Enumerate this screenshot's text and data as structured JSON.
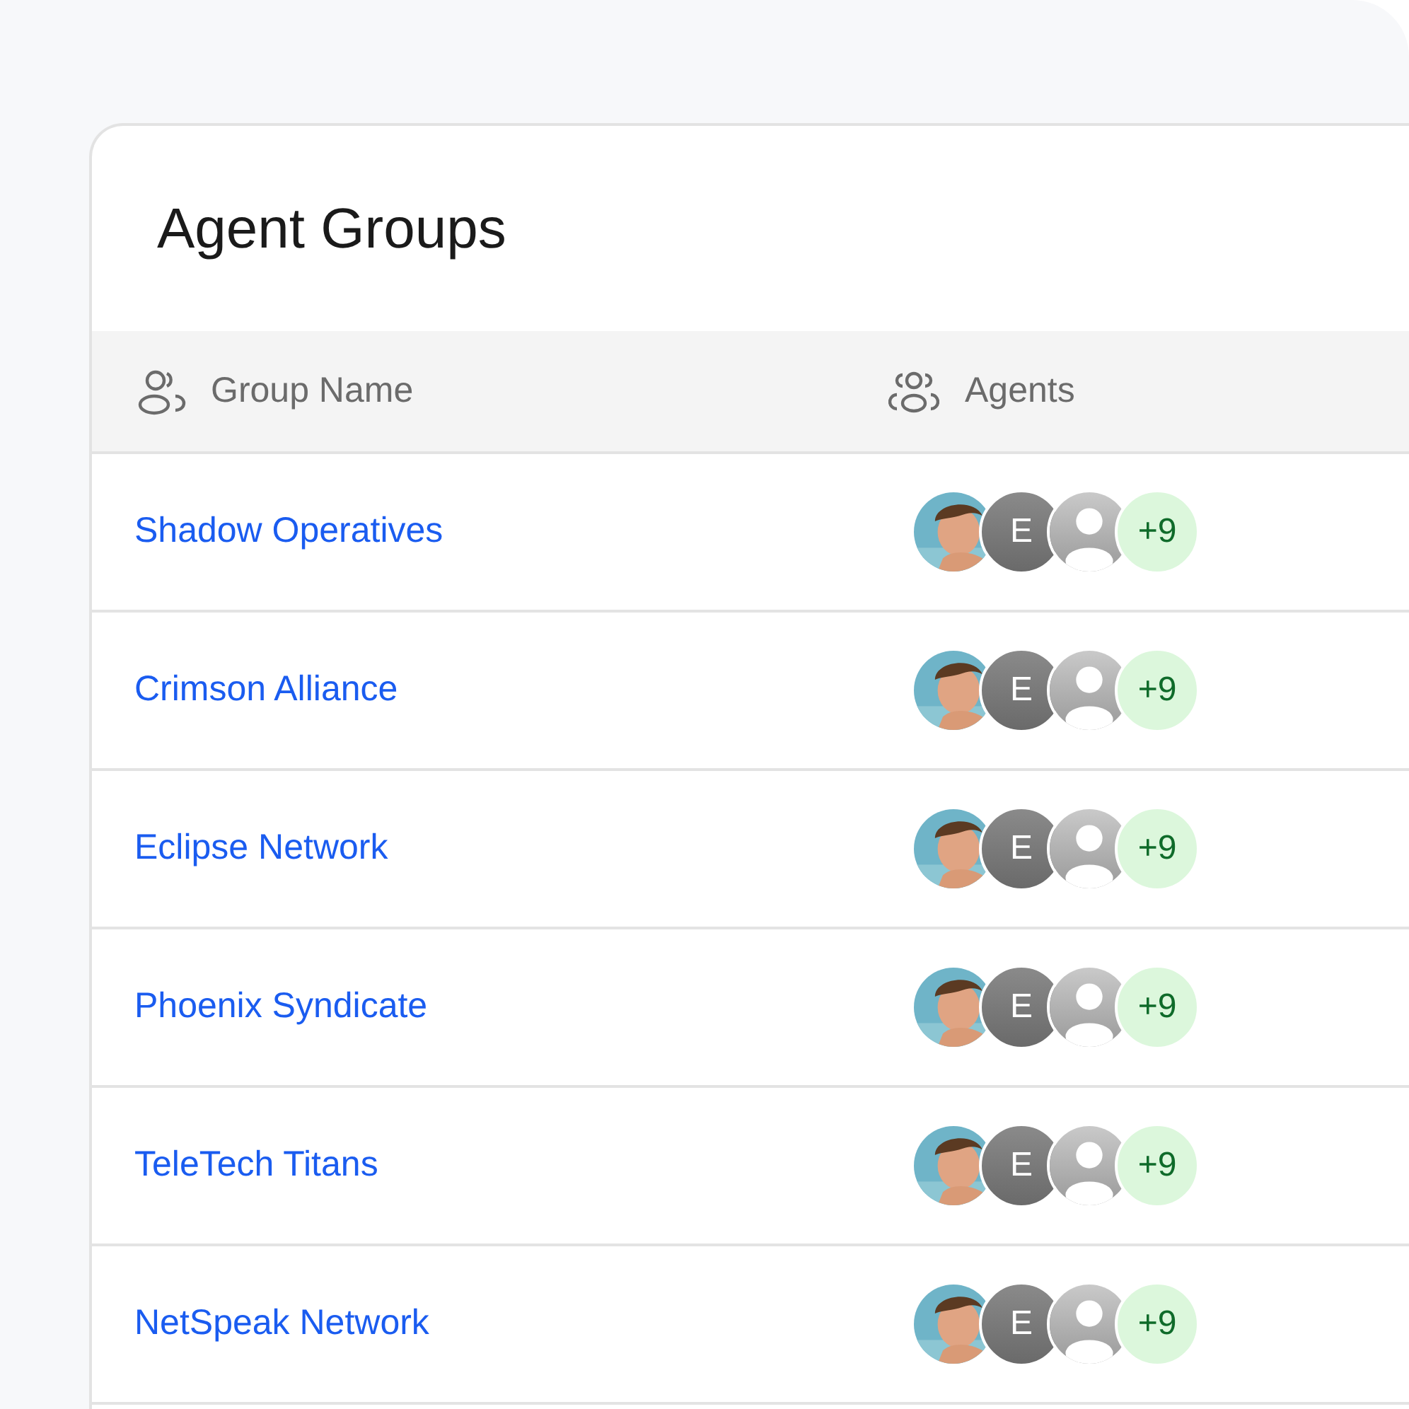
{
  "title": "Agent Groups",
  "columns": [
    {
      "label": "Group Name",
      "kind": "person"
    },
    {
      "label": "Agents",
      "kind": "group"
    }
  ],
  "rows": [
    {
      "name": "Shadow Operatives",
      "agents": [
        {
          "kind": "picture"
        },
        {
          "kind": "initial",
          "text": "E"
        },
        {
          "kind": "placeholder"
        },
        {
          "kind": "count",
          "text": "+9"
        }
      ]
    },
    {
      "name": "Crimson Alliance",
      "agents": [
        {
          "kind": "picture"
        },
        {
          "kind": "initial",
          "text": "E"
        },
        {
          "kind": "placeholder"
        },
        {
          "kind": "count",
          "text": "+9"
        }
      ]
    },
    {
      "name": "Eclipse Network",
      "agents": [
        {
          "kind": "picture"
        },
        {
          "kind": "initial",
          "text": "E"
        },
        {
          "kind": "placeholder"
        },
        {
          "kind": "count",
          "text": "+9"
        }
      ]
    },
    {
      "name": "Phoenix Syndicate",
      "agents": [
        {
          "kind": "picture"
        },
        {
          "kind": "initial",
          "text": "E"
        },
        {
          "kind": "placeholder"
        },
        {
          "kind": "count",
          "text": "+9"
        }
      ]
    },
    {
      "name": "TeleTech Titans",
      "agents": [
        {
          "kind": "picture"
        },
        {
          "kind": "initial",
          "text": "E"
        },
        {
          "kind": "placeholder"
        },
        {
          "kind": "count",
          "text": "+9"
        }
      ]
    },
    {
      "name": "NetSpeak Network",
      "agents": [
        {
          "kind": "picture"
        },
        {
          "kind": "initial",
          "text": "E"
        },
        {
          "kind": "placeholder"
        },
        {
          "kind": "count",
          "text": "+9"
        }
      ]
    }
  ]
}
